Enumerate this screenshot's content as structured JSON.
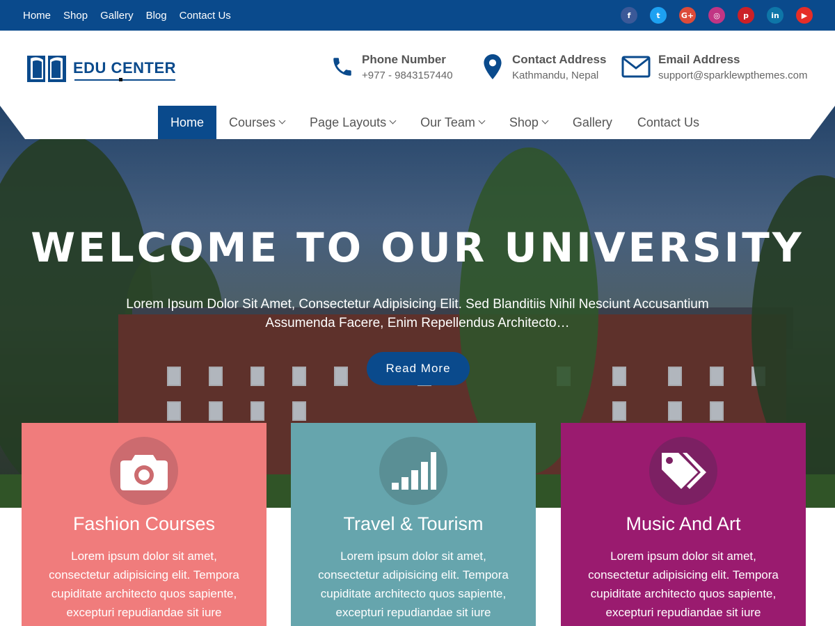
{
  "topbar": {
    "links": [
      "Home",
      "Shop",
      "Gallery",
      "Blog",
      "Contact Us"
    ],
    "social": [
      {
        "icon": "facebook-icon",
        "glyph": "f",
        "color": "#3b5998"
      },
      {
        "icon": "twitter-icon",
        "glyph": "t",
        "color": "#1da1f2"
      },
      {
        "icon": "google-plus-icon",
        "glyph": "G+",
        "color": "#dd4b39"
      },
      {
        "icon": "instagram-icon",
        "glyph": "◎",
        "color": "#c13584"
      },
      {
        "icon": "pinterest-icon",
        "glyph": "p",
        "color": "#cb2027"
      },
      {
        "icon": "linkedin-icon",
        "glyph": "in",
        "color": "#0e76a8"
      },
      {
        "icon": "youtube-icon",
        "glyph": "▶",
        "color": "#e52d27"
      }
    ]
  },
  "header": {
    "logo_text": "EDU CENTER",
    "phone": {
      "title": "Phone Number",
      "value": "+977 - 9843157440"
    },
    "address": {
      "title": "Contact Address",
      "value": "Kathmandu, Nepal"
    },
    "email": {
      "title": "Email Address",
      "value": "support@sparklewpthemes.com"
    }
  },
  "mainnav": {
    "home": "Home",
    "courses": "Courses",
    "page_layouts": "Page Layouts",
    "our_team": "Our Team",
    "shop": "Shop",
    "gallery": "Gallery",
    "contact": "Contact Us"
  },
  "hero": {
    "title": "WELCOME TO OUR UNIVERSITY",
    "description": "Lorem Ipsum Dolor Sit Amet, Consectetur Adipisicing Elit. Sed Blanditiis Nihil Nesciunt Accusantium Assumenda Facere, Enim Repellendus Architecto…",
    "button": "Read More"
  },
  "cards": [
    {
      "title": "Fashion Courses",
      "text": "Lorem ipsum dolor sit amet, consectetur adipisicing elit. Tempora cupiditate architecto quos sapiente, excepturi repudiandae sit iure",
      "color": "#f07c7c",
      "icon": "camera-icon"
    },
    {
      "title": "Travel & Tourism",
      "text": "Lorem ipsum dolor sit amet, consectetur adipisicing elit. Tempora cupiditate architecto quos sapiente, excepturi repudiandae sit iure",
      "color": "#66a5ad",
      "icon": "signal-bars-icon"
    },
    {
      "title": "Music And Art",
      "text": "Lorem ipsum dolor sit amet, consectetur adipisicing elit. Tempora cupiditate architecto quos sapiente, excepturi repudiandae sit iure",
      "color": "#9a1b6f",
      "icon": "tags-icon"
    }
  ],
  "colors": {
    "brand": "#0a4a8c"
  }
}
